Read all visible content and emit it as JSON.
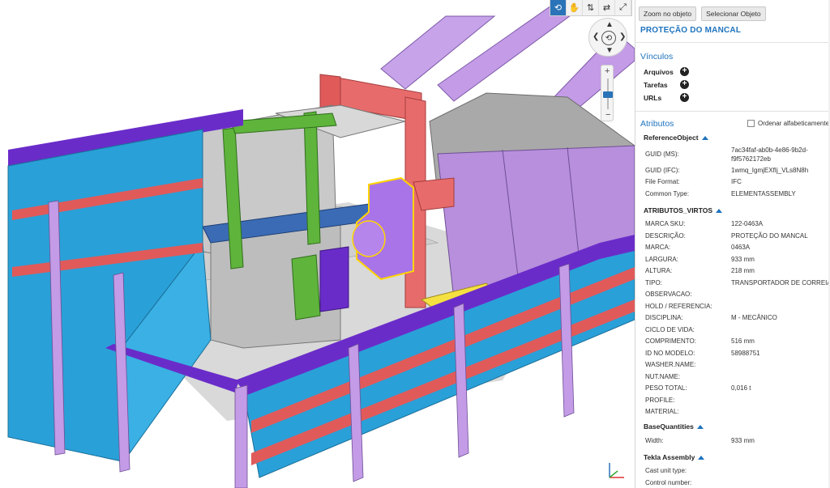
{
  "viewport": {
    "toolbar_icons": [
      "orbit-icon",
      "pan-icon",
      "walk-icon",
      "swap-icon",
      "fit-icon"
    ],
    "toolbar_glyphs": [
      "⟲",
      "✋",
      "⇅",
      "⇄",
      "⤢"
    ],
    "nav": {
      "up": "▲",
      "down": "▼",
      "left": "❮",
      "right": "❯",
      "center": "⟲"
    },
    "zoom": {
      "plus": "+",
      "minus": "−"
    },
    "colors": {
      "rail_purple": "#6a2cc9",
      "panel_blue": "#2aa0d8",
      "steel_red": "#e05a5a",
      "steel_grey": "#bdbdbd",
      "pipe_violet": "#c39be6",
      "stiffener_green": "#5fb43c",
      "selection_yellow": "#ffd400",
      "selected_violet": "#a974e8"
    }
  },
  "panel": {
    "buttons": {
      "zoom": "Zoom no objeto",
      "select": "Selecionar Objeto"
    },
    "object_title": "PROTEÇÃO DO MANCAL",
    "links": {
      "title": "Vínculos",
      "items": [
        "Arquivos",
        "Tarefas",
        "URLs"
      ]
    },
    "attributes": {
      "title": "Atributos",
      "sort_label": "Ordenar alfabeticamente",
      "reference_object": {
        "title": "ReferenceObject",
        "rows": [
          {
            "k": "GUID (MS):",
            "v": "7ac34faf-ab0b-4e86-9b2d-",
            "v2": "f9f5762172eb"
          },
          {
            "k": "GUID (IFC):",
            "v": "1wmq_IgmjEXfIj_VLs8N8h"
          },
          {
            "k": "File Format:",
            "v": "IFC"
          },
          {
            "k": "Common Type:",
            "v": "ELEMENTASSEMBLY"
          }
        ]
      },
      "virtos": {
        "title": "ATRIBUTOS_VIRTOS",
        "rows": [
          {
            "k": "MARCA SKU:",
            "v": "122-0463A"
          },
          {
            "k": "DESCRIÇÃO:",
            "v": "PROTEÇÃO DO MANCAL"
          },
          {
            "k": "MARCA:",
            "v": "0463A"
          },
          {
            "k": "LARGURA:",
            "v": "933 mm"
          },
          {
            "k": "ALTURA:",
            "v": "218 mm"
          },
          {
            "k": "TIPO:",
            "v": "TRANSPORTADOR DE CORREIA"
          },
          {
            "k": "OBSERVACAO:",
            "v": ""
          },
          {
            "k": "HOLD / REFERENCIA:",
            "v": ""
          },
          {
            "k": "DISCIPLINA:",
            "v": "M - MECÂNICO"
          },
          {
            "k": "CICLO DE VIDA:",
            "v": ""
          },
          {
            "k": "COMPRIMENTO:",
            "v": "516 mm"
          },
          {
            "k": "ID NO MODELO:",
            "v": "58988751"
          },
          {
            "k": "WASHER.NAME:",
            "v": ""
          },
          {
            "k": "NUT.NAME:",
            "v": ""
          },
          {
            "k": "PESO TOTAL:",
            "v": "0,016 t"
          },
          {
            "k": "PROFILE:",
            "v": ""
          },
          {
            "k": "MATERIAL:",
            "v": ""
          }
        ]
      },
      "base_quantities": {
        "title": "BaseQuantities",
        "rows": [
          {
            "k": "Width:",
            "v": "933 mm"
          }
        ]
      },
      "tekla": {
        "title": "Tekla Assembly",
        "rows": [
          {
            "k": "Cast unit type:",
            "v": ""
          },
          {
            "k": "Control number:",
            "v": ""
          }
        ]
      }
    }
  }
}
